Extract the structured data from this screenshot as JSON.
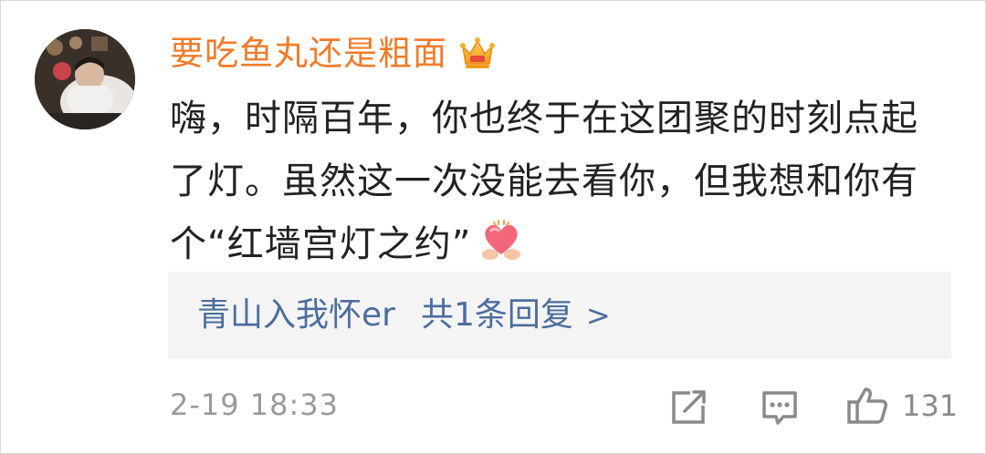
{
  "comment": {
    "username": "要吃鱼丸还是粗面",
    "badge_icon": "crown-icon",
    "text": "嗨，时隔百年，你也终于在这团聚的时刻点起了灯。虽然这一次没能去看你，但我想和你有个“红墙宫灯之约”",
    "emoji_icon": "heart-hands-icon",
    "timestamp": "2-19 18:33",
    "username_color": "#f07b29"
  },
  "reply": {
    "author": "青山入我怀er",
    "count_label": "共1条回复",
    "arrow": ">",
    "link_color": "#4c6d9e"
  },
  "actions": {
    "share_icon": "share-icon",
    "comment_icon": "comment-icon",
    "like_icon": "thumbs-up-icon",
    "like_count": "131"
  }
}
